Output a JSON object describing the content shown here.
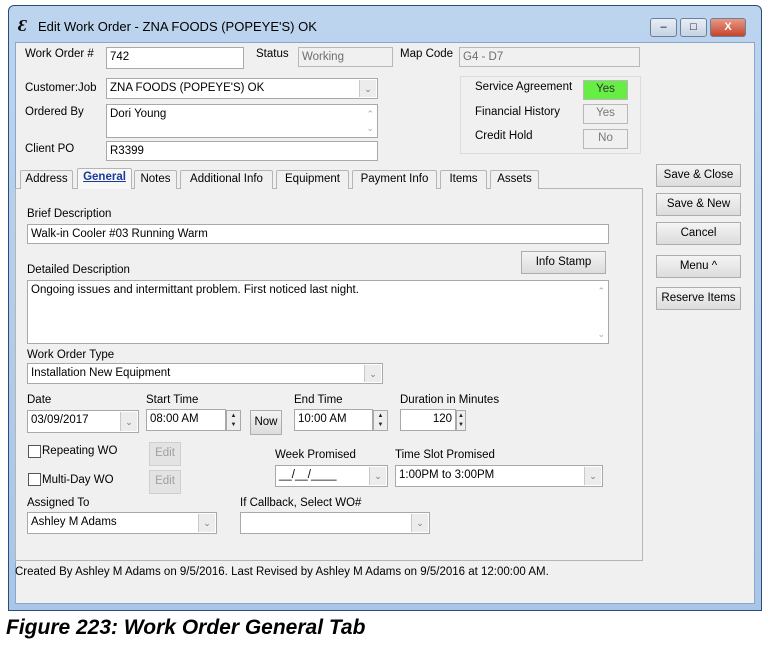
{
  "window": {
    "title": "Edit Work Order - ZNA FOODS (POPEYE'S) OK",
    "app_icon": "e-logo-icon",
    "minimize": "–",
    "maximize": "□",
    "close": "X"
  },
  "header": {
    "work_order_label": "Work Order #",
    "work_order_value": "742",
    "status_label": "Status",
    "status_value": "Working",
    "map_code_label": "Map Code",
    "map_code_value": "G4 - D7",
    "customer_job_label": "Customer:Job",
    "customer_job_value": "ZNA FOODS (POPEYE'S) OK",
    "ordered_by_label": "Ordered By",
    "ordered_by_value": "Dori Young",
    "client_po_label": "Client PO",
    "client_po_value": "R3399"
  },
  "flags": {
    "service_agreement_label": "Service Agreement",
    "service_agreement_value": "Yes",
    "service_agreement_color": "#66ee44",
    "financial_history_label": "Financial History",
    "financial_history_value": "Yes",
    "credit_hold_label": "Credit Hold",
    "credit_hold_value": "No"
  },
  "tabs": [
    {
      "label": "Address"
    },
    {
      "label": "General",
      "active": true
    },
    {
      "label": "Notes"
    },
    {
      "label": "Additional Info"
    },
    {
      "label": "Equipment"
    },
    {
      "label": "Payment Info"
    },
    {
      "label": "Items"
    },
    {
      "label": "Assets"
    }
  ],
  "side_buttons": {
    "save_close": "Save & Close",
    "save_new": "Save & New",
    "cancel": "Cancel",
    "menu": "Menu ^",
    "reserve_items": "Reserve Items"
  },
  "general": {
    "brief_label": "Brief Description",
    "brief_value": "Walk-in Cooler #03 Running Warm",
    "detailed_label": "Detailed Description",
    "detailed_value": "Ongoing issues and intermittant problem. First noticed last night.",
    "info_stamp": "Info Stamp",
    "type_label": "Work Order Type",
    "type_value": "Installation New Equipment",
    "date_label": "Date",
    "date_value": "03/09/2017",
    "start_label": "Start Time",
    "start_value": "08:00 AM",
    "now": "Now",
    "end_label": "End Time",
    "end_value": "10:00 AM",
    "duration_label": "Duration in Minutes",
    "duration_value": "120",
    "repeating_label": "Repeating WO",
    "multiday_label": "Multi-Day WO",
    "edit": "Edit",
    "week_label": "Week Promised",
    "week_value": "__/__/____",
    "slot_label": "Time Slot Promised",
    "slot_value": "1:00PM to 3:00PM",
    "assigned_label": "Assigned To",
    "assigned_value": "Ashley M Adams",
    "callback_label": "If Callback, Select WO#",
    "callback_value": ""
  },
  "status_bar": "Created By Ashley M Adams on 9/5/2016.  Last Revised by Ashley M Adams on 9/5/2016 at 12:00:00 AM.",
  "caption": "Figure 223: Work Order General Tab"
}
